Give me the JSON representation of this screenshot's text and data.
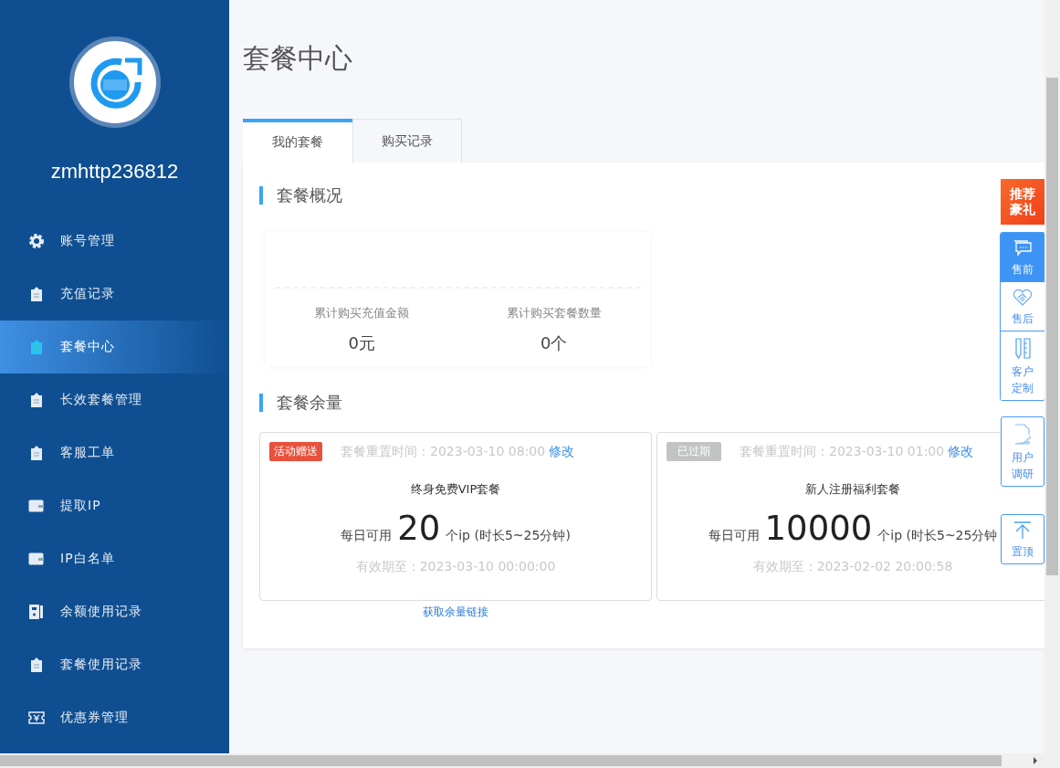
{
  "sidebar": {
    "username": "zmhttp236812",
    "items": [
      {
        "label": "账号管理",
        "kind": "gear",
        "selected": false
      },
      {
        "label": "充值记录",
        "kind": "clipboard",
        "selected": false
      },
      {
        "label": "套餐中心",
        "kind": "clipboard",
        "selected": true
      },
      {
        "label": "长效套餐管理",
        "kind": "clipboard",
        "selected": false
      },
      {
        "label": "客服工单",
        "kind": "clipboard",
        "selected": false
      },
      {
        "label": "提取IP",
        "kind": "wallet",
        "selected": false
      },
      {
        "label": "IP白名单",
        "kind": "wallet",
        "selected": false
      },
      {
        "label": "余额使用记录",
        "kind": "ledger",
        "selected": false
      },
      {
        "label": "套餐使用记录",
        "kind": "clipboard",
        "selected": false
      },
      {
        "label": "优惠券管理",
        "kind": "coupon",
        "selected": false
      }
    ]
  },
  "page_title": "套餐中心",
  "tabs": [
    {
      "label": "我的套餐",
      "selected": true
    },
    {
      "label": "购买记录",
      "selected": false
    }
  ],
  "overview": {
    "title": "套餐概况",
    "stats": [
      {
        "label": "累计购买充值金额",
        "value": "0元"
      },
      {
        "label": "累计购买套餐数量",
        "value": "0个"
      }
    ]
  },
  "balance": {
    "title": "套餐余量",
    "packages": [
      {
        "badge": "活动赠送",
        "kind": "promo",
        "reset_label": "套餐重置时间：2023-03-10 08:00",
        "edit_link": "修改",
        "name": "终身免费VIP套餐",
        "daily_prefix": "每日可用",
        "daily_count": "20",
        "daily_suffix": "个ip (时长5~25分钟)",
        "expiry": "有效期至：2023-03-10 00:00:00"
      },
      {
        "badge": "已过期",
        "kind": "expired",
        "reset_label": "套餐重置时间：2023-03-10 01:00",
        "edit_link": "修改",
        "name": "新人注册福利套餐",
        "daily_prefix": "每日可用",
        "daily_count": "10000",
        "daily_suffix": "个ip (时长5~25分钟",
        "expiry": "有效期至：2023-02-02 20:00:58"
      }
    ],
    "link": "获取余量链接"
  },
  "float_panel": {
    "promo": "推荐豪礼",
    "buttons": [
      {
        "label": "售前",
        "kind": "chat",
        "selected": true
      },
      {
        "label": "售后",
        "kind": "handshake",
        "selected": false
      },
      {
        "label": "客户定制",
        "kind": "ruler",
        "selected": false
      }
    ],
    "survey": "用户调研",
    "top": "置顶"
  }
}
